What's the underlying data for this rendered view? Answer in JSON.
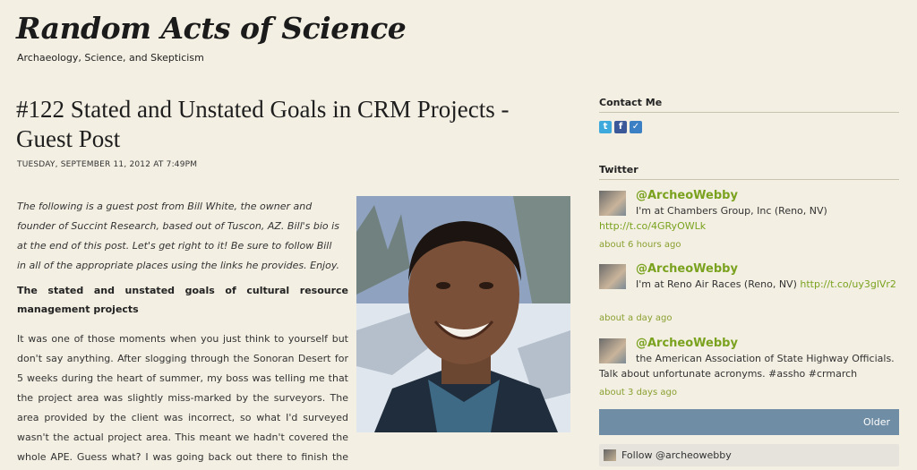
{
  "header": {
    "title": "Random Acts of Science",
    "tagline": "Archaeology, Science, and Skepticism"
  },
  "post": {
    "title": "#122 Stated and Unstated Goals in CRM Projects - Guest Post",
    "date": "Tuesday, September 11, 2012 at 7:49PM",
    "intro": "The following is a guest post from Bill White, the owner and founder of Succint Research, based out of Tuscon, AZ.  Bill's bio is at the end of this post.  Let's get right to it!  Be sure to follow Bill in all of the appropriate places using the links he provides.  Enjoy.",
    "section_heading": "The stated and unstated goals of cultural resource management projects",
    "body": "It was one of those moments when you just think to yourself but don't say anything. After slogging through the Sonoran Desert for 5 weeks during the heart of summer, my boss was telling me that the project area was slightly miss-marked by the surveyors. The area provided by the client was incorrect, so what I'd surveyed wasn't the actual project area. This meant we hadn't covered the whole APE. Guess what? I was going back out there to finish the job."
  },
  "sidebar": {
    "contact_heading": "Contact Me",
    "social_icons": [
      "twitter-icon",
      "facebook-icon",
      "email-icon"
    ],
    "twitter_heading": "Twitter",
    "tweets": [
      {
        "user": "@ArcheoWebby",
        "text": "I'm at Chambers Group, Inc (Reno, NV) ",
        "link": "http://t.co/4GRyOWLk",
        "time": "about 6 hours ago"
      },
      {
        "user": "@ArcheoWebby",
        "text": "I'm at Reno Air Races (Reno, NV) ",
        "link": "http://t.co/uy3glVr2",
        "time": "about a day ago"
      },
      {
        "user": "@ArcheoWebby",
        "text": "the American Association of State Highway Officials. Talk about unfortunate acronyms. #assho #crmarch",
        "link": "",
        "time": "about 3 days ago"
      }
    ],
    "older_label": "Older",
    "follow_label": "Follow @archeowebby"
  },
  "colors": {
    "background": "#f3efe3",
    "link_green": "#7aa21e",
    "older_bar": "#6f8da5"
  }
}
